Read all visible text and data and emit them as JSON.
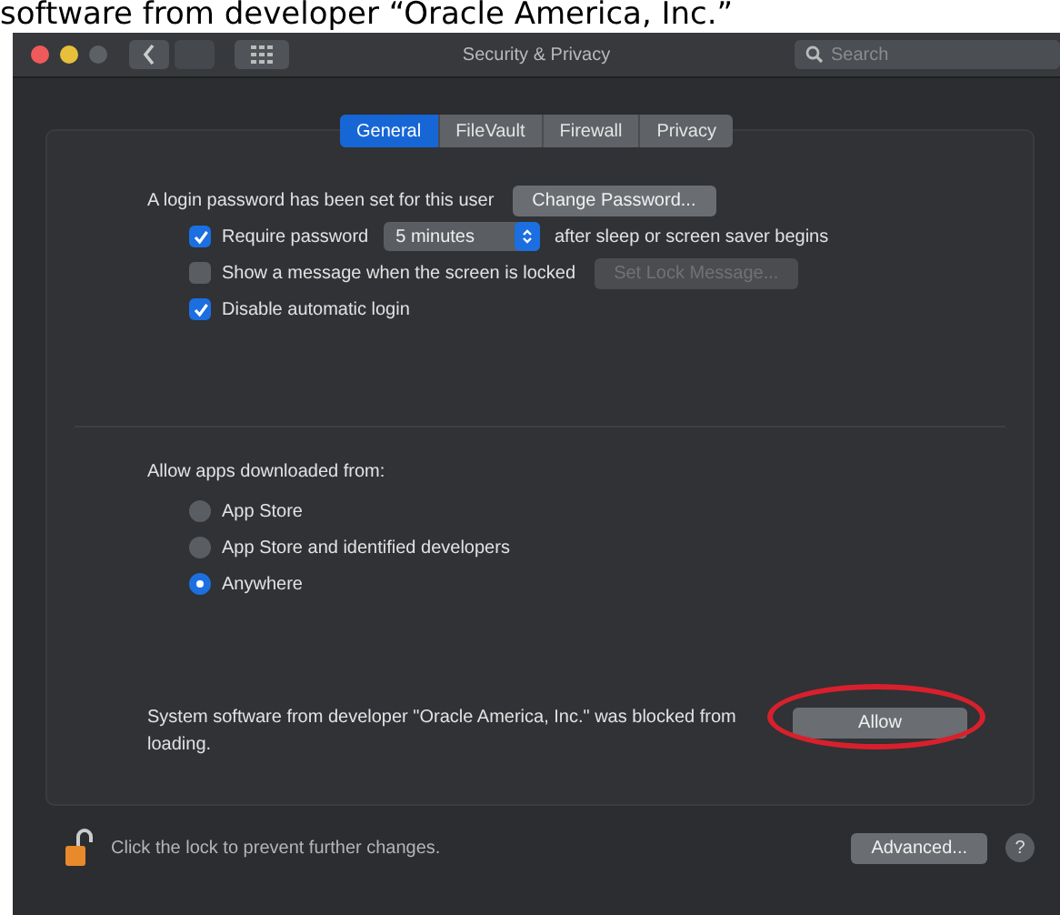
{
  "caption": "software from developer “Oracle America, Inc.”",
  "window": {
    "title": "Security & Privacy",
    "search": {
      "placeholder": "Search"
    }
  },
  "tabs": [
    {
      "label": "General",
      "selected": true
    },
    {
      "label": "FileVault",
      "selected": false
    },
    {
      "label": "Firewall",
      "selected": false
    },
    {
      "label": "Privacy",
      "selected": false
    }
  ],
  "login": {
    "text": "A login password has been set for this user",
    "button": "Change Password..."
  },
  "options": [
    {
      "kind": "select",
      "checked": true,
      "label": "Require password",
      "select": "5 minutes",
      "suffix": "after sleep or screen saver begins"
    },
    {
      "kind": "button",
      "checked": false,
      "label": "Show a message when the screen is locked",
      "button": "Set Lock Message...",
      "disabled": true
    },
    {
      "kind": "plain",
      "checked": true,
      "label": "Disable automatic login"
    }
  ],
  "allow": {
    "label": "Allow apps downloaded from:",
    "choices": [
      {
        "label": "App Store",
        "selected": false
      },
      {
        "label": "App Store and identified developers",
        "selected": false
      },
      {
        "label": "Anywhere",
        "selected": true
      }
    ]
  },
  "blocked": {
    "text": "System software from developer \"Oracle America, Inc.\" was blocked from loading.",
    "button": "Allow",
    "circled": true
  },
  "footer": {
    "locked": false,
    "text": "Click the lock to prevent further changes.",
    "button": "Advanced...",
    "help": "?"
  }
}
